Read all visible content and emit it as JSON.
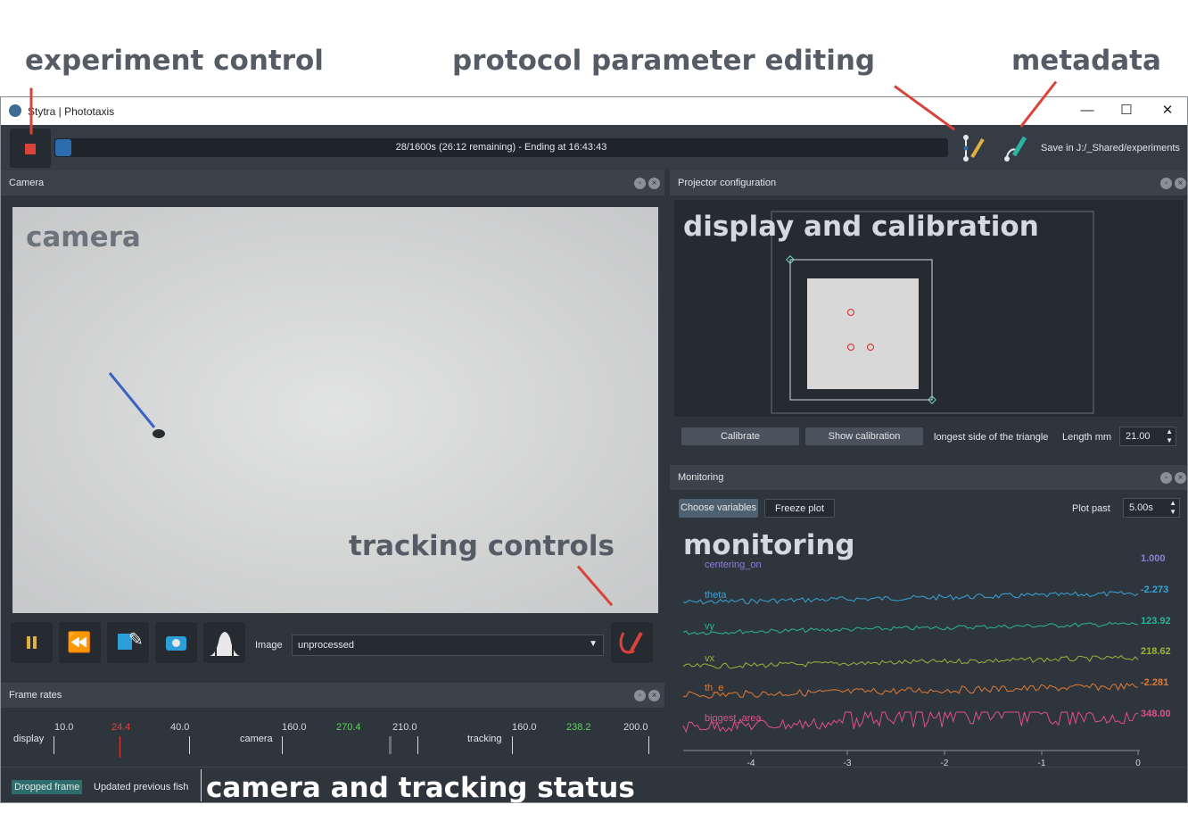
{
  "annotations": {
    "experiment_control": "experiment control",
    "protocol_editing": "protocol parameter editing",
    "metadata": "metadata",
    "camera": "camera",
    "display_calibration": "display and calibration",
    "tracking_controls": "tracking controls",
    "monitoring": "monitoring",
    "status": "camera and tracking status"
  },
  "window": {
    "title": "Stytra | Phototaxis",
    "minimize": "—",
    "maximize": "☐",
    "close": "✕"
  },
  "toolbar": {
    "progress_text": "28/1600s (26:12 remaining) - Ending at 16:43:43",
    "progress_fraction": 0.0175,
    "save_label": "Save in J:/_Shared/experiments",
    "edit_icon": "protocol-edit-icon",
    "meta_icon": "metadata-edit-icon"
  },
  "camera_panel": {
    "title": "Camera",
    "image_label": "Image",
    "image_value": "unprocessed"
  },
  "projector_panel": {
    "title": "Projector configuration",
    "calibrate": "Calibrate",
    "show_calibration": "Show calibration",
    "triangle_label": "longest side of the triangle",
    "length_label": "Length mm",
    "length_value": "21.00"
  },
  "monitoring_panel": {
    "title": "Monitoring",
    "choose_variables": "Choose variables",
    "freeze_plot": "Freeze plot",
    "plot_past_label": "Plot past",
    "plot_past_value": "5.00s",
    "traces": [
      {
        "name": "centering_on",
        "value": "1.000",
        "color": "#8f7fd8"
      },
      {
        "name": "theta",
        "value": "-2.273",
        "color": "#3aa3d8"
      },
      {
        "name": "vy",
        "value": "123.92",
        "color": "#2bb59a"
      },
      {
        "name": "vx",
        "value": "218.62",
        "color": "#98b53a"
      },
      {
        "name": "th_e",
        "value": "-2.281",
        "color": "#e07a35"
      },
      {
        "name": "biggest_area",
        "value": "348.00",
        "color": "#e0508a"
      }
    ],
    "x_ticks": [
      "-4",
      "-3",
      "-2",
      "-1",
      "0"
    ]
  },
  "frame_rates": {
    "title": "Frame rates",
    "display": {
      "label": "display",
      "min": "10.0",
      "current": "24.4",
      "max": "40.0",
      "current_color": "#e0403a"
    },
    "camera": {
      "label": "camera",
      "min": "160.0",
      "current": "270.4",
      "max": "210.0",
      "current_color": "#5fd35f"
    },
    "tracking": {
      "label": "tracking",
      "min": "160.0",
      "current": "238.2",
      "max": "200.0",
      "current_color": "#5fd35f"
    }
  },
  "status": {
    "dropped_frame": "Dropped frame",
    "updated": "Updated previous fish"
  },
  "colors": {
    "accent_red": "#d9433a",
    "progress_blue": "#2c6db0",
    "bg_dark": "#2f353d"
  }
}
